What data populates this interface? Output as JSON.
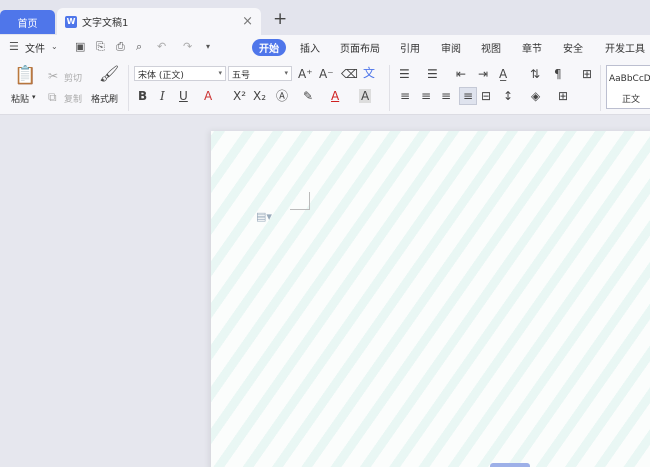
{
  "tabs": {
    "home": "首页",
    "doc_title": "文字文稿1",
    "doc_logo": "W",
    "close_icon": "×",
    "new_tab": "+"
  },
  "menubar": {
    "file": "文件",
    "items": [
      "开始",
      "插入",
      "页面布局",
      "引用",
      "审阅",
      "视图",
      "章节",
      "安全",
      "开发工具"
    ],
    "active": "开始"
  },
  "ribbon": {
    "paste": "粘贴",
    "cut": "剪切",
    "copy": "复制",
    "format_painter": "格式刷",
    "font_name": "宋体 (正文)",
    "font_size": "五号",
    "style_preview": "AaBbCcD",
    "style_name": "正文"
  },
  "colors": {
    "accent": "#4f76ea",
    "tabbar_bg": "#e3e4ed",
    "ribbon_bg": "#f7f7fa",
    "workspace_bg": "#e6e7ee"
  }
}
